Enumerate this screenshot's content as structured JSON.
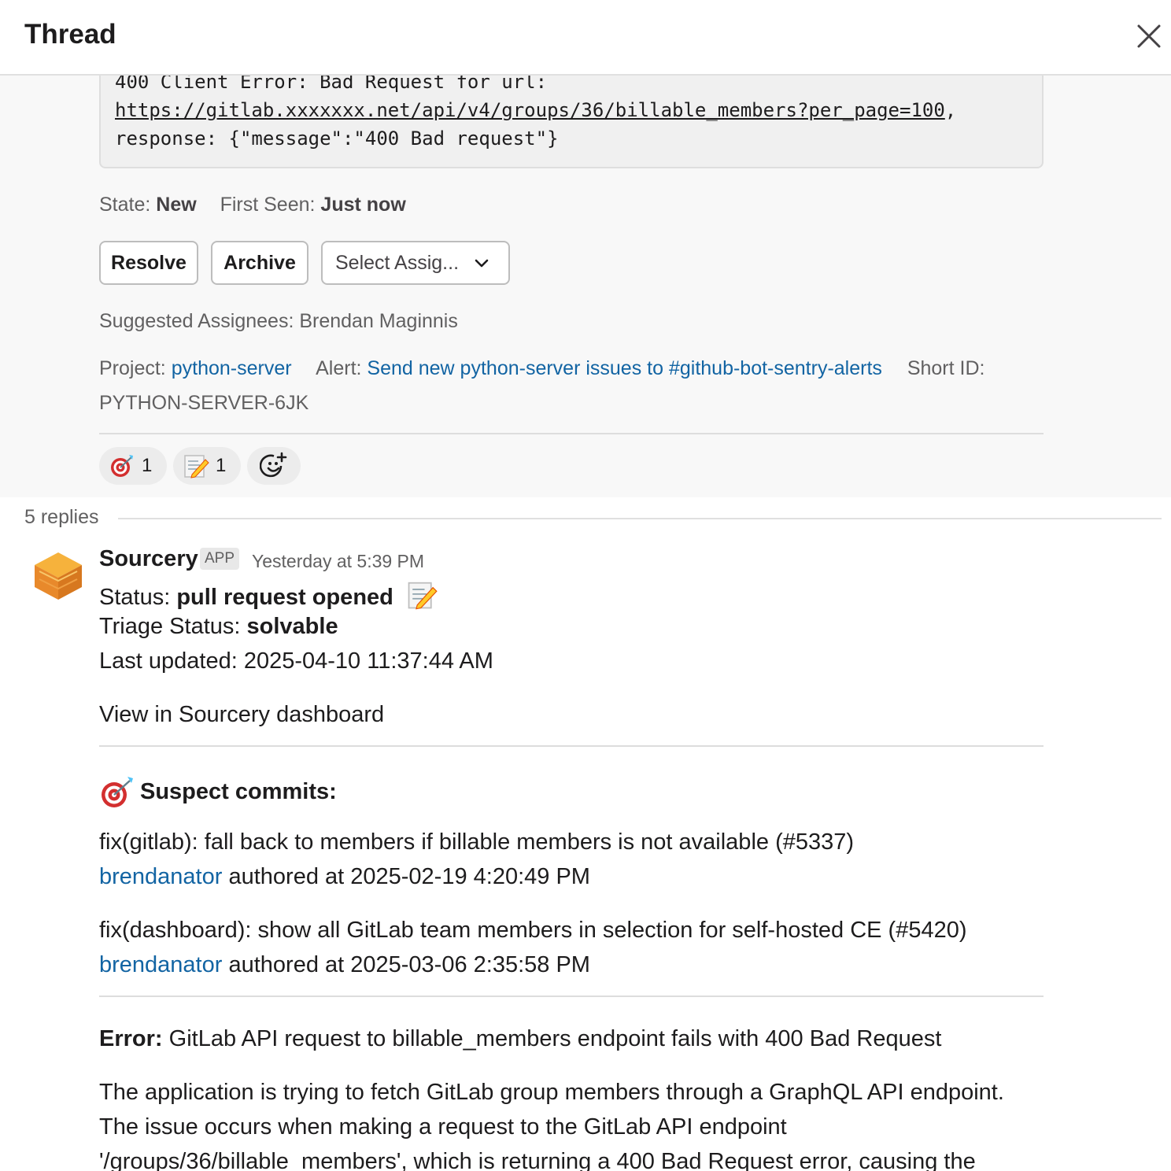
{
  "header": {
    "title": "Thread"
  },
  "parent": {
    "code": {
      "line1": "400 Client Error: Bad Request for url:",
      "link": "https://gitlab.xxxxxxx.net/api/v4/groups/36/billable_members?per_page=100",
      "link_suffix": ",",
      "line3": "response: {\"message\":\"400 Bad request\"}"
    },
    "state_label": "State:",
    "state_value": "New",
    "first_seen_label": "First Seen:",
    "first_seen_value": "Just now",
    "buttons": {
      "resolve": "Resolve",
      "archive": "Archive",
      "select_assignee": "Select Assig..."
    },
    "suggested": "Suggested Assignees: Brendan Maginnis",
    "project_label": "Project:",
    "project_value": "python-server",
    "alert_label": "Alert:",
    "alert_value": "Send new python-server issues to #github-bot-sentry-alerts",
    "short_id_label": "Short ID:",
    "short_id_value": "PYTHON-SERVER-6JK",
    "reactions": [
      {
        "emoji": "target-dart-icon",
        "count": "1"
      },
      {
        "emoji": "memo-pencil-icon",
        "count": "1"
      }
    ]
  },
  "replies": {
    "count_label": "5 replies"
  },
  "message": {
    "author": "Sourcery",
    "badge": "APP",
    "time": "Yesterday at 5:39 PM",
    "status_label": "Status:",
    "status_value": "pull request opened",
    "triage_label": "Triage Status:",
    "triage_value": "solvable",
    "last_updated": "Last updated: 2025-04-10 11:37:44 AM",
    "dashboard_link": "View in Sourcery dashboard",
    "suspect_title": "Suspect commits:",
    "commits": [
      {
        "title": "fix(gitlab): fall back to members if billable members is not available (#5337)",
        "author": "brendanator",
        "authored": "authored at 2025-02-19 4:20:49 PM"
      },
      {
        "title": "fix(dashboard): show all GitLab team members in selection for self-hosted CE (#5420)",
        "author": "brendanator",
        "authored": "authored at 2025-03-06 2:35:58 PM"
      }
    ],
    "error_label": "Error:",
    "error_text": "GitLab API request to billable_members endpoint fails with 400 Bad Request",
    "desc_line1": "The application is trying to fetch GitLab group members through a GraphQL API endpoint.",
    "desc_line2": "The issue occurs when making a request to the GitLab API endpoint",
    "desc_line3": "'/groups/36/billable_members', which is returning a 400 Bad Request error, causing the"
  },
  "colors": {
    "link": "#1264a3",
    "text": "#1d1c1d",
    "muted": "#616061"
  }
}
